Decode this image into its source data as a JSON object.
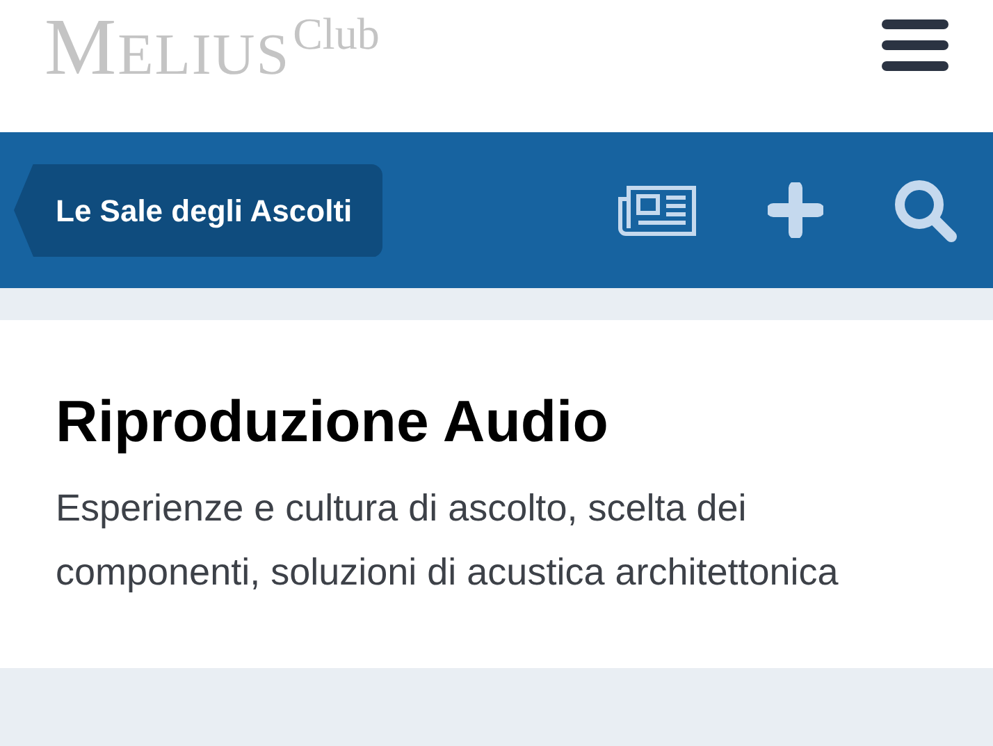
{
  "header": {
    "logo": {
      "name": "MELIUS",
      "superscript": "Club"
    }
  },
  "nav_bar": {
    "breadcrumb": "Le Sale degli Ascolti"
  },
  "forum": {
    "title": "Riproduzione Audio",
    "description": "Esperienze e cultura di ascolto, scelta dei componenti, soluzioni di acustica architettonica"
  }
}
